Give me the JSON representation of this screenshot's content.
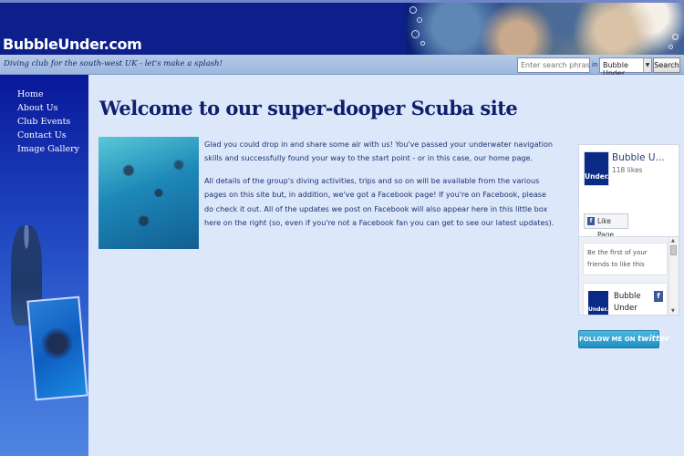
{
  "header": {
    "site_name": "BubbleUnder.com",
    "tagline": "Diving club for the south-west UK - let's make a splash!"
  },
  "search": {
    "placeholder": "Enter search phrase",
    "in_label": "in",
    "scope_value": "Bubble Under",
    "button_label": "Search"
  },
  "nav": {
    "items": [
      {
        "label": "Home"
      },
      {
        "label": "About Us"
      },
      {
        "label": "Club Events"
      },
      {
        "label": "Contact Us"
      },
      {
        "label": "Image Gallery"
      }
    ]
  },
  "main": {
    "title": "Welcome to our super-dooper Scuba site",
    "paragraphs": [
      "Glad you could drop in and share some air with us! You've passed your underwater navigation skills and successfully found your way to the start point - or in this case, our home page.",
      "All details of the group's diving activities, trips and so on will be available from the various pages on this site but, in addition, we've got a Facebook page! If you're on Facebook, please do check it out. All of the updates we post on Facebook will also appear here in this little box here on the right (so, even if you're not a Facebook fan you can get to see our latest updates)."
    ]
  },
  "facebook": {
    "page_name": "Bubble U...",
    "likes": "118 likes",
    "logo_text": "Under.",
    "like_button": "Like Page",
    "first_friends": "Be the first of your friends to like this",
    "post_name": "Bubble Under",
    "post_logo_text": "Under."
  },
  "twitter": {
    "label_prefix": "FOLLOW ME ON",
    "label_brand": "twitter"
  },
  "colors": {
    "header_bg": "#0d1f8a",
    "sidebar_top": "#08189a",
    "main_bg": "#dce8fa",
    "title_color": "#0e1f6d",
    "facebook_blue": "#3b5998",
    "twitter_blue": "#1f8fc4"
  }
}
